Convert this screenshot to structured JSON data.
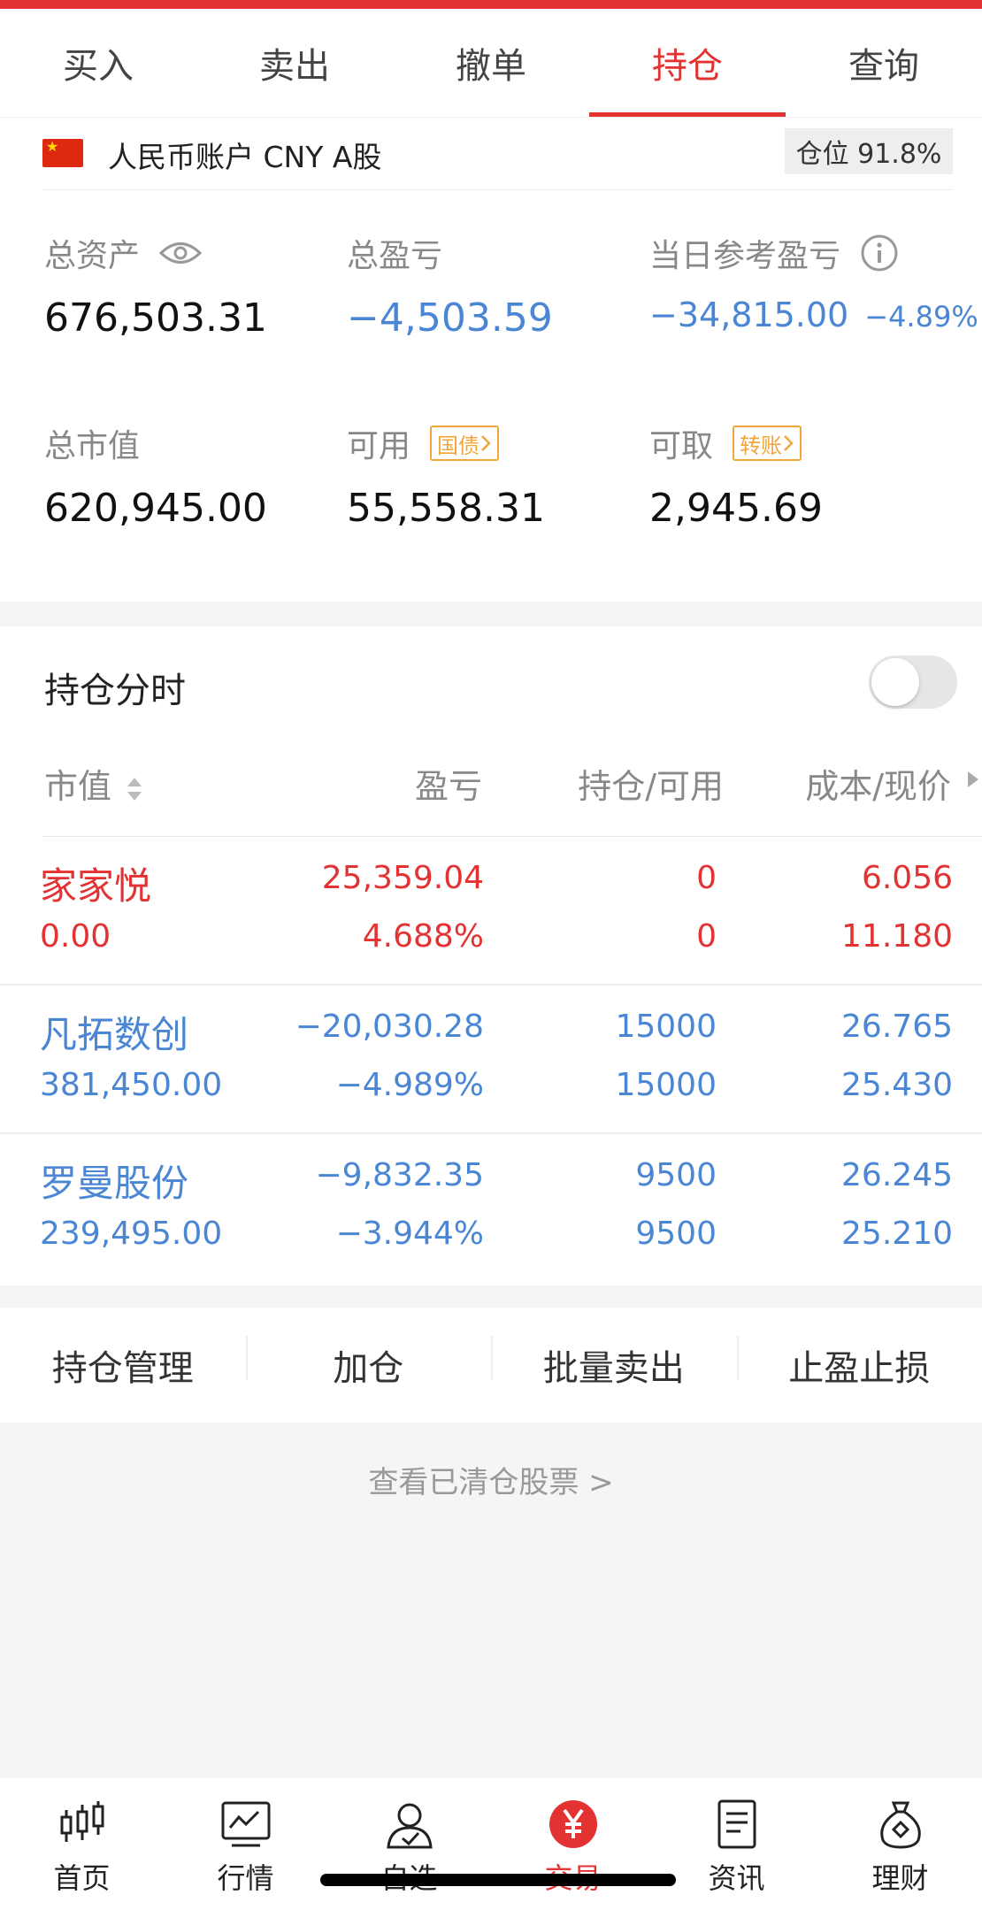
{
  "tabs": [
    {
      "label": "买入",
      "active": false
    },
    {
      "label": "卖出",
      "active": false
    },
    {
      "label": "撤单",
      "active": false
    },
    {
      "label": "持仓",
      "active": true
    },
    {
      "label": "查询",
      "active": false
    }
  ],
  "account": {
    "name": "人民币账户 CNY A股",
    "position_label": "仓位 91.8%"
  },
  "summary": {
    "total_assets": {
      "label": "总资产",
      "value": "676,503.31"
    },
    "total_pl": {
      "label": "总盈亏",
      "value": "−4,503.59"
    },
    "today_pl": {
      "label": "当日参考盈亏",
      "value": "−34,815.00",
      "pct": "−4.89%"
    },
    "market_value": {
      "label": "总市值",
      "value": "620,945.00"
    },
    "available": {
      "label": "可用",
      "tag": "国债",
      "value": "55,558.31"
    },
    "withdrawable": {
      "label": "可取",
      "tag": "转账",
      "value": "2,945.69"
    }
  },
  "holdings": {
    "title": "持仓分时",
    "toggle_on": false,
    "columns": [
      "市值",
      "盈亏",
      "持仓/可用",
      "成本/现价"
    ],
    "rows": [
      {
        "name": "家家悦",
        "market_value": "0.00",
        "pl": "25,359.04",
        "pl_pct": "4.688%",
        "position": "0",
        "available": "0",
        "cost": "6.056",
        "price": "11.180",
        "color": "#e33232"
      },
      {
        "name": "凡拓数创",
        "market_value": "381,450.00",
        "pl": "−20,030.28",
        "pl_pct": "−4.989%",
        "position": "15000",
        "available": "15000",
        "cost": "26.765",
        "price": "25.430",
        "color": "#4a86d3"
      },
      {
        "name": "罗曼股份",
        "market_value": "239,495.00",
        "pl": "−9,832.35",
        "pl_pct": "−3.944%",
        "position": "9500",
        "available": "9500",
        "cost": "26.245",
        "price": "25.210",
        "color": "#4a86d3"
      }
    ]
  },
  "actions": [
    "持仓管理",
    "加仓",
    "批量卖出",
    "止盈止损"
  ],
  "cleared_link": "查看已清仓股票  >",
  "nav": [
    {
      "label": "首页",
      "icon": "candlestick-icon",
      "active": false
    },
    {
      "label": "行情",
      "icon": "chart-icon",
      "active": false
    },
    {
      "label": "自选",
      "icon": "user-icon",
      "active": false
    },
    {
      "label": "交易",
      "icon": "yen-icon",
      "active": true
    },
    {
      "label": "资讯",
      "icon": "document-icon",
      "active": false
    },
    {
      "label": "理财",
      "icon": "money-bag-icon",
      "active": false
    }
  ],
  "colors": {
    "accent": "#e33232",
    "down": "#4a86d3",
    "tag": "#f0a63a"
  }
}
